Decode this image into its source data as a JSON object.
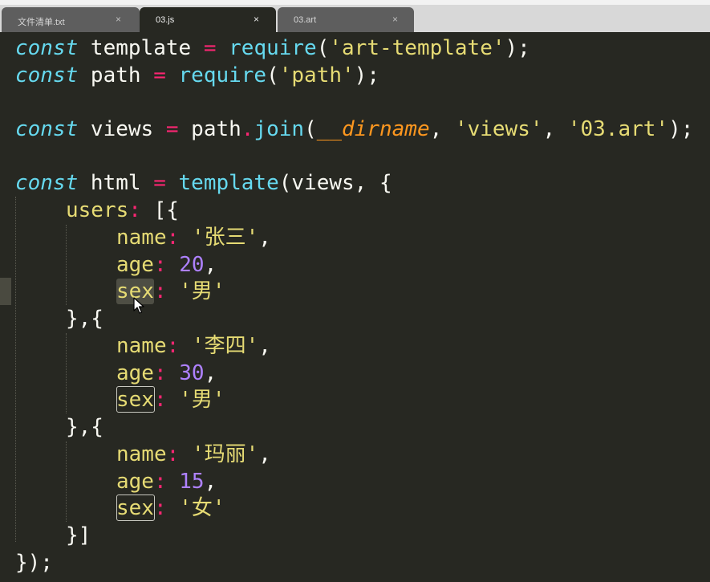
{
  "tabs": [
    {
      "label": "文件清单.txt",
      "close": "×",
      "active": false
    },
    {
      "label": "03.js",
      "close": "×",
      "active": true
    },
    {
      "label": "03.art",
      "close": "×",
      "active": false
    }
  ],
  "code": {
    "l1": {
      "kw": "const",
      "id": " template ",
      "op": "=",
      "fn": " require",
      "p1": "(",
      "str": "'art-template'",
      "p2": ");"
    },
    "l2": {
      "kw": "const",
      "id": " path ",
      "op": "=",
      "fn": " require",
      "p1": "(",
      "str": "'path'",
      "p2": ");"
    },
    "l4": {
      "kw": "const",
      "id": " views ",
      "op": "=",
      "obj": " path",
      "dot": ".",
      "fn": "join",
      "p1": "(",
      "param": "__dirname",
      "c1": ", ",
      "s1": "'views'",
      "c2": ", ",
      "s2": "'03.art'",
      "p2": ");"
    },
    "l6": {
      "kw": "const",
      "id": " html ",
      "op": "=",
      "fn": " template",
      "p1": "(views, {"
    },
    "l7": {
      "prop": "users",
      "c": ":",
      "p": " [{"
    },
    "users": [
      {
        "name_key": "name",
        "name_val": "'张三'",
        "age_key": "age",
        "age_val": "20",
        "sex_key": "sex",
        "sex_val": "'男'"
      },
      {
        "name_key": "name",
        "name_val": "'李四'",
        "age_key": "age",
        "age_val": "30",
        "sex_key": "sex",
        "sex_val": "'男'"
      },
      {
        "name_key": "name",
        "name_val": "'玛丽'",
        "age_key": "age",
        "age_val": "15",
        "sex_key": "sex",
        "sex_val": "'女'"
      }
    ],
    "sep": "},{",
    "close_arr": "}]",
    "close_all": "});",
    "colon": ":",
    "comma": ","
  }
}
